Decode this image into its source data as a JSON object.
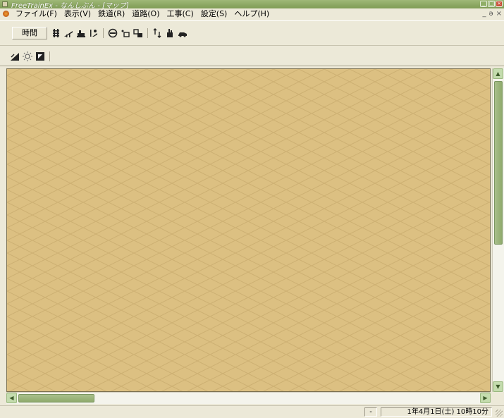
{
  "window": {
    "title": "FreeTrainEx - なんしぶん - [マップ]",
    "caption_buttons": [
      "_",
      "□",
      "×"
    ]
  },
  "menubar": {
    "items": [
      "ファイル(F)",
      "表示(V)",
      "鉄道(R)",
      "道路(O)",
      "工事(C)",
      "設定(S)",
      "ヘルプ(H)"
    ],
    "mdi_buttons": [
      "_",
      "ə",
      "×"
    ]
  },
  "toolbar1": {
    "time_label": "時間",
    "icons": [
      "rail-track-icon",
      "bridge-icon",
      "station-icon",
      "platform-icon",
      "signal-icon",
      "road-icon",
      "building-icon",
      "train-icon",
      "slope-icon",
      "structure-icon",
      "car-icon"
    ]
  },
  "toolbar2": {
    "icons": [
      "terrain-icon",
      "sun-icon",
      "night-icon"
    ]
  },
  "map": {
    "ground_color": "#dcc082",
    "grid_color": "#cfb274"
  },
  "statusbar": {
    "minus_label": "-",
    "datetime": "1年4月1日(土) 10時10分"
  },
  "colors": {
    "titlebar": "#8faa66",
    "scrollbar_thumb": "#9ab27a",
    "window_face": "#ece9d8"
  }
}
